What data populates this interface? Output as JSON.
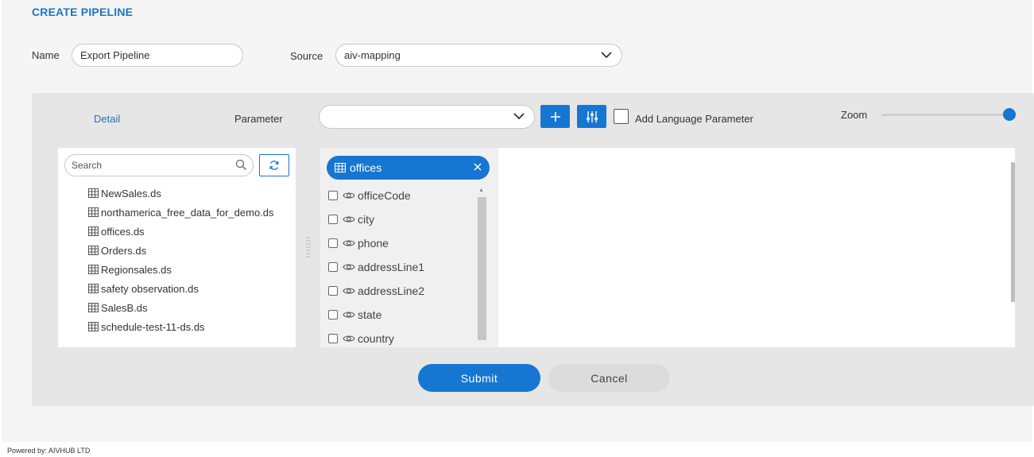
{
  "page": {
    "title": "CREATE PIPELINE"
  },
  "form": {
    "name_label": "Name",
    "name_value": "Export Pipeline",
    "source_label": "Source",
    "source_value": "aiv-mapping"
  },
  "toolbar": {
    "detail_label": "Detail",
    "parameter_label": "Parameter",
    "parameter_value": "",
    "add_language_label": "Add Language Parameter",
    "zoom_label": "Zoom",
    "zoom_level": 1.0
  },
  "tree": {
    "search_placeholder": "Search",
    "items": [
      {
        "label": "NewSales.ds"
      },
      {
        "label": "northamerica_free_data_for_demo.ds"
      },
      {
        "label": "offices.ds"
      },
      {
        "label": "Orders.ds"
      },
      {
        "label": "Regionsales.ds"
      },
      {
        "label": "safety observation.ds"
      },
      {
        "label": "SalesB.ds"
      },
      {
        "label": "schedule-test-11-ds.ds"
      }
    ]
  },
  "fields": {
    "table_name": "offices",
    "items": [
      {
        "label": "officeCode"
      },
      {
        "label": "city"
      },
      {
        "label": "phone"
      },
      {
        "label": "addressLine1"
      },
      {
        "label": "addressLine2"
      },
      {
        "label": "state"
      },
      {
        "label": "country"
      }
    ]
  },
  "actions": {
    "submit_label": "Submit",
    "cancel_label": "Cancel"
  },
  "footer": {
    "text": "Powered by: AIVHUB LTD"
  },
  "colors": {
    "accent": "#1677d2",
    "title": "#1f73c1",
    "panel": "#e6e6e6"
  }
}
